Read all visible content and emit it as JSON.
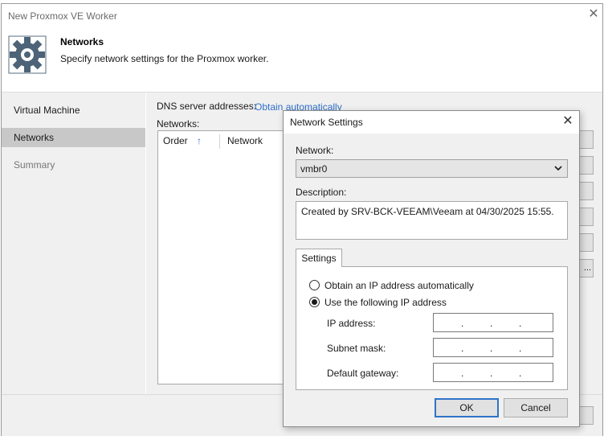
{
  "background_window": {
    "title": "New Proxmox VE Worker",
    "header": {
      "title": "Networks",
      "subtitle": "Specify network settings for the Proxmox worker.",
      "icon": "gear-icon"
    },
    "nav": [
      {
        "label": "Virtual Machine",
        "state": "normal"
      },
      {
        "label": "Networks",
        "state": "active"
      },
      {
        "label": "Summary",
        "state": "disabled"
      }
    ],
    "dns_label": "DNS server addresses:",
    "dns_link": "Obtain automatically",
    "networks_label": "Networks:",
    "columns": {
      "order": "Order",
      "network": "Network"
    },
    "side_more_label": "..."
  },
  "dialog": {
    "title": "Network Settings",
    "network_label": "Network:",
    "network_value": "vmbr0",
    "description_label": "Description:",
    "description_value": "Created by SRV-BCK-VEEAM\\Veeam at 04/30/2025 15:55.",
    "tab_settings": "Settings",
    "radio_auto": "Obtain an IP address automatically",
    "radio_manual": "Use the following IP address",
    "selected_mode": "manual",
    "fields": {
      "ip_label": "IP address:",
      "mask_label": "Subnet mask:",
      "gateway_label": "Default gateway:"
    },
    "ok_label": "OK",
    "cancel_label": "Cancel"
  },
  "colors": {
    "accent": "#2f73c9",
    "link": "#2f6fc7",
    "nav_active": "#c8c8c8",
    "panel_bg": "#f0f0f0"
  }
}
